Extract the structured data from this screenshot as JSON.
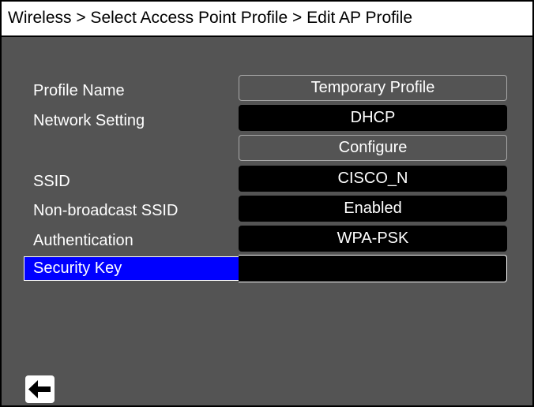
{
  "header": {
    "breadcrumb": "Wireless > Select Access Point Profile > Edit AP Profile"
  },
  "form": {
    "profile_name": {
      "label": "Profile Name",
      "value": "Temporary Profile"
    },
    "network_setting": {
      "label": "Network Setting",
      "value": "DHCP"
    },
    "configure": {
      "label": "Configure"
    },
    "ssid": {
      "label": "SSID",
      "value": "CISCO_N"
    },
    "non_broadcast_ssid": {
      "label": "Non-broadcast SSID",
      "value": "Enabled"
    },
    "authentication": {
      "label": "Authentication",
      "value": "WPA-PSK"
    },
    "security_key": {
      "label": "Security Key",
      "value": ""
    }
  },
  "footer": {
    "back_icon": "left-arrow-icon"
  },
  "colors": {
    "background": "#545454",
    "selection": "#0000ff",
    "value_field": "#000000",
    "text": "#ffffff"
  }
}
